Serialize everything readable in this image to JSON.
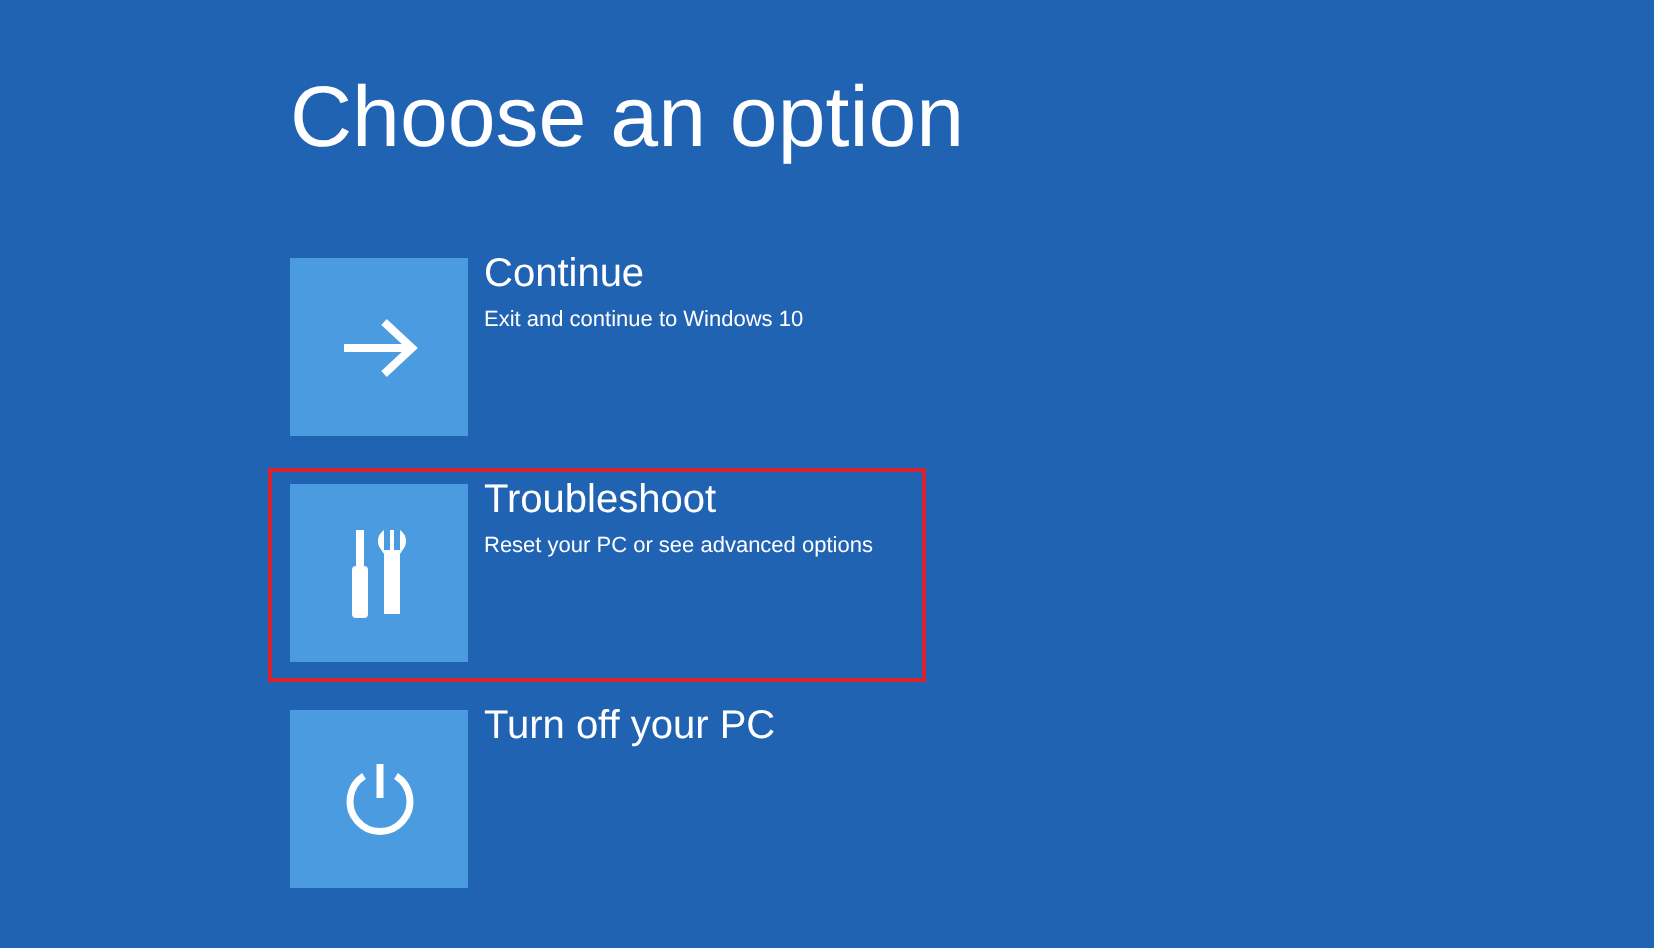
{
  "title": "Choose an option",
  "options": [
    {
      "kind": "arrow",
      "label": "Continue",
      "description": "Exit and continue to Windows 10",
      "highlighted": false
    },
    {
      "kind": "tools",
      "label": "Troubleshoot",
      "description": "Reset your PC or see advanced options",
      "highlighted": true
    },
    {
      "kind": "power",
      "label": "Turn off your PC",
      "highlighted": false
    }
  ]
}
